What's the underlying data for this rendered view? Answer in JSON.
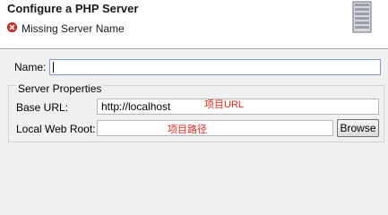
{
  "header": {
    "title": "Configure a PHP Server",
    "message": "Missing Server Name"
  },
  "form": {
    "name_label": "Name:",
    "name_value": "",
    "group_title": "Server Properties",
    "base_url_label": "Base URL:",
    "base_url_value": "http://localhost",
    "base_url_annotation": "项目URL",
    "web_root_label": "Local Web Root:",
    "web_root_value": "",
    "web_root_annotation": "项目路径",
    "browse_label": "Browse"
  },
  "colors": {
    "error": "#d8332b",
    "annotation": "#e8261a",
    "focus_border": "#7a9ccc"
  },
  "icons": [
    "error-icon",
    "server-icon"
  ]
}
